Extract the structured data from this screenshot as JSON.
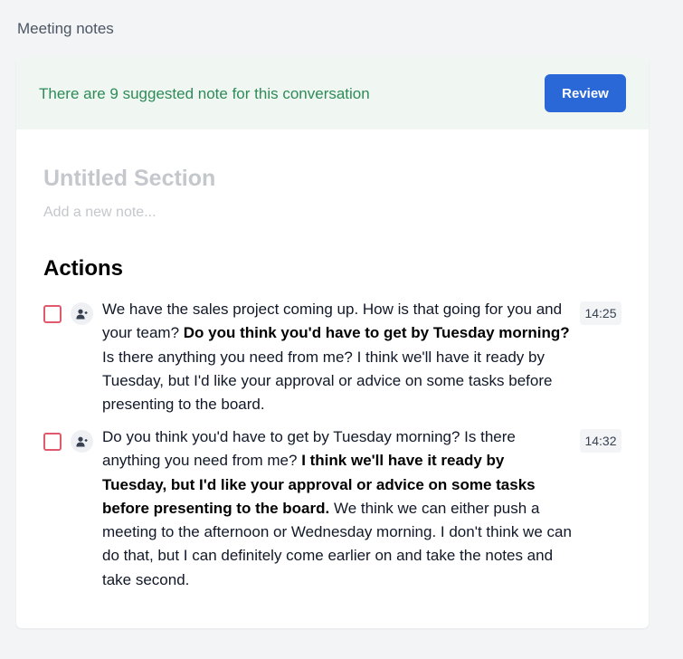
{
  "page": {
    "heading": "Meeting notes"
  },
  "banner": {
    "message": "There are 9 suggested note for this conversation",
    "review_label": "Review"
  },
  "section": {
    "title": "Untitled Section",
    "note_placeholder": "Add a new note..."
  },
  "actions": {
    "title": "Actions",
    "items": [
      {
        "time": "14:25",
        "segments": [
          {
            "text": "We have the sales project coming up. How is that going for you and your team? ",
            "bold": false
          },
          {
            "text": "Do you think you'd have to get by Tuesday morning?",
            "bold": true
          },
          {
            "text": " Is there anything you need from me? I think we'll have it ready by Tuesday, but I'd like your approval or advice on some tasks before presenting to the board.",
            "bold": false
          }
        ]
      },
      {
        "time": "14:32",
        "segments": [
          {
            "text": "Do you think you'd have to get by Tuesday morning? Is there anything you need from me? ",
            "bold": false
          },
          {
            "text": "I think we'll have it ready by Tuesday, but I'd like your approval or advice on some tasks before presenting to the board.",
            "bold": true
          },
          {
            "text": " We think we can either push a meeting to the afternoon or Wednesday morning. I don't think we can do that, but I can definitely come earlier on and take the notes and take second.",
            "bold": false
          }
        ]
      }
    ]
  },
  "colors": {
    "banner_bg": "#f0f7f3",
    "banner_text": "#2e8b57",
    "button_bg": "#2a68d8",
    "checkbox_border": "#e0596d"
  },
  "icons": {
    "assign": "person-add-icon"
  }
}
